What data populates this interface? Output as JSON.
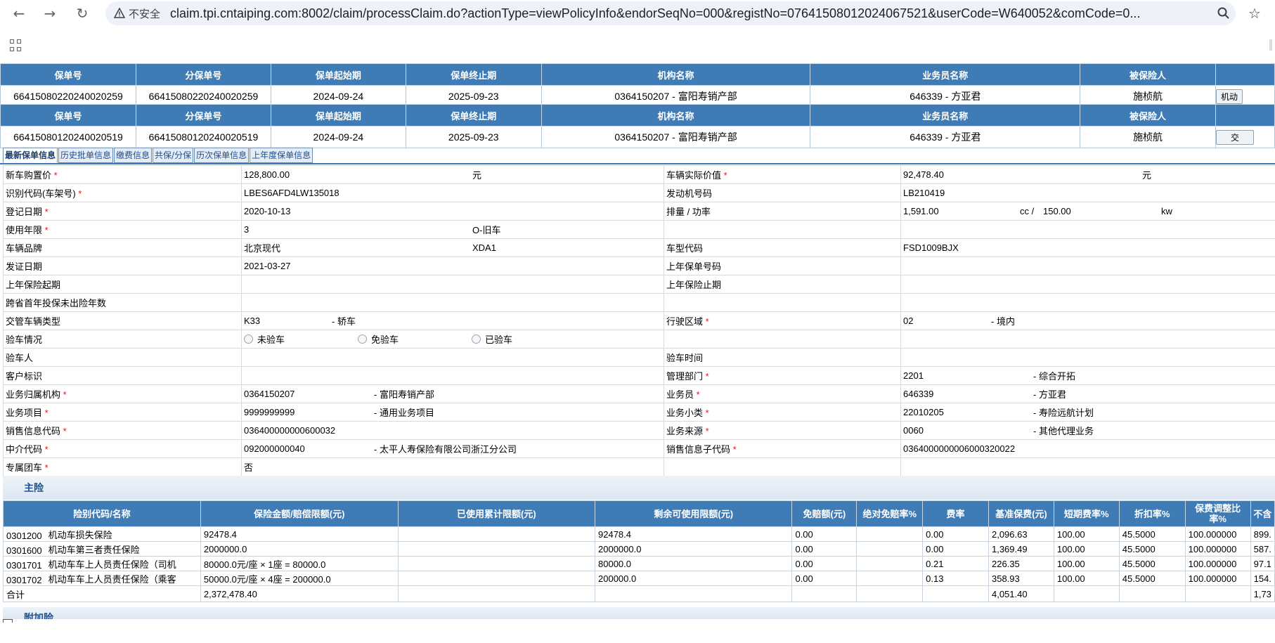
{
  "browser": {
    "insecure_label": "不安全",
    "url": "claim.tpi.cntaiping.com:8002/claim/processClaim.do?actionType=viewPolicyInfo&endorSeqNo=000&registNo=07641508012024067521&userCode=W640052&comCode=0..."
  },
  "policy_headers": [
    "保单号",
    "分保单号",
    "保单起始期",
    "保单终止期",
    "机构名称",
    "业务员名称",
    "被保险人",
    ""
  ],
  "policies": [
    {
      "policy_no": "66415080220240020259",
      "sub_policy_no": "66415080220240020259",
      "start": "2024-09-24",
      "end": "2025-09-23",
      "org": "0364150207 - 富阳寿销产部",
      "agent": "646339 - 方亚君",
      "insured": "施桢航",
      "action": "机动"
    },
    {
      "policy_no": "66415080120240020519",
      "sub_policy_no": "66415080120240020519",
      "start": "2024-09-24",
      "end": "2025-09-23",
      "org": "0364150207 - 富阳寿销产部",
      "agent": "646339 - 方亚君",
      "insured": "施桢航",
      "action": "交"
    }
  ],
  "tabs": [
    "最新保单信息",
    "历史批单信息",
    "缴费信息",
    "共保/分保",
    "历次保单信息",
    "上年度保单信息"
  ],
  "info": {
    "new_car_price_label": "新车购置价",
    "new_car_price": "128,800.00",
    "yuan": "元",
    "actual_value_label": "车辆实际价值",
    "actual_value": "92,478.40",
    "vin_label": "识别代码(车架号)",
    "vin": "LBES6AFD4LW135018",
    "engine_label": "发动机号码",
    "engine": "LB210419",
    "reg_date_label": "登记日期",
    "reg_date": "2020-10-13",
    "displacement_label": "排量 / 功率",
    "displacement": "1,591.00",
    "cc": "cc /",
    "power": "150.00",
    "kw": "kw",
    "years_label": "使用年限",
    "years": "3",
    "car_age": "O-旧车",
    "brand_label": "车辆品牌",
    "brand": "北京现代",
    "brand_code": "XDA1",
    "model_code_label": "车型代码",
    "model_code": "FSD1009BJX",
    "issue_date_label": "发证日期",
    "issue_date": "2021-03-27",
    "last_policy_label": "上年保单号码",
    "last_start_label": "上年保险起期",
    "last_end_label": "上年保险止期",
    "cross_province_label": "跨省首年投保未出险年数",
    "vehicle_type_label": "交管车辆类型",
    "vehicle_type_code": "K33",
    "vehicle_type": "-  轿车",
    "area_label": "行驶区域",
    "area_code": "02",
    "area": "-  境内",
    "inspect_label": "验车情况",
    "inspect_opt1": "未验车",
    "inspect_opt2": "免验车",
    "inspect_opt3": "已验车",
    "inspector_label": "验车人",
    "inspect_time_label": "验车时间",
    "customer_label": "客户标识",
    "mgmt_dept_label": "管理部门",
    "mgmt_dept_code": "2201",
    "mgmt_dept": "-  综合开拓",
    "org_label": "业务归属机构",
    "org_code": "0364150207",
    "org_name": "-  富阳寿销产部",
    "agent_label": "业务员",
    "agent_code": "646339",
    "agent_name": "-  方亚君",
    "project_label": "业务项目",
    "project_code": "9999999999",
    "project_name": "-  通用业务项目",
    "subclass_label": "业务小类",
    "subclass_code": "22010205",
    "subclass_name": "-  寿险远航计划",
    "sales_code_label": "销售信息代码",
    "sales_code": "036400000000600032",
    "source_label": "业务来源",
    "source_code": "0060",
    "source_name": "-  其他代理业务",
    "broker_label": "中介代码",
    "broker_code": "092000000040",
    "broker_name": "-  太平人寿保险有限公司浙江分公司",
    "sales_sub_label": "销售信息子代码",
    "sales_sub": "0364000000006000320022",
    "fleet_label": "专属团车",
    "fleet": "否"
  },
  "main_section": "主险",
  "addon_section": "附加险",
  "coverage": {
    "headers": [
      "险别代码/名称",
      "保险金额/赔偿限额(元)",
      "已使用累计限额(元)",
      "剩余可使用限额(元)",
      "免赔额(元)",
      "绝对免赔率%",
      "费率",
      "基准保费(元)",
      "短期费率%",
      "折扣率%",
      "保费调整比率%",
      "不含"
    ],
    "rows": [
      {
        "code": "0301200",
        "name": "机动车损失保险",
        "amount": "92478.4",
        "used": "",
        "remain": "92478.4",
        "deductible": "0.00",
        "abs_rate": "",
        "rate": "0.00",
        "base": "2,096.63",
        "short": "100.00",
        "discount": "45.5000",
        "adjust": "100.000000",
        "net": "899."
      },
      {
        "code": "0301600",
        "name": "机动车第三者责任保险",
        "amount": "2000000.0",
        "used": "",
        "remain": "2000000.0",
        "deductible": "0.00",
        "abs_rate": "",
        "rate": "0.00",
        "base": "1,369.49",
        "short": "100.00",
        "discount": "45.5000",
        "adjust": "100.000000",
        "net": "587."
      },
      {
        "code": "0301701",
        "name": "机动车车上人员责任保险（司机",
        "amount": "80000.0元/座 × 1座 = 80000.0",
        "used": "",
        "remain": "80000.0",
        "deductible": "0.00",
        "abs_rate": "",
        "rate": "0.21",
        "base": "226.35",
        "short": "100.00",
        "discount": "45.5000",
        "adjust": "100.000000",
        "net": "97.1"
      },
      {
        "code": "0301702",
        "name": "机动车车上人员责任保险（乘客",
        "amount": "50000.0元/座 × 4座 = 200000.0",
        "used": "",
        "remain": "200000.0",
        "deductible": "0.00",
        "abs_rate": "",
        "rate": "0.13",
        "base": "358.93",
        "short": "100.00",
        "discount": "45.5000",
        "adjust": "100.000000",
        "net": "154."
      }
    ],
    "total_label": "合计",
    "total_amount": "2,372,478.40",
    "total_base": "4,051.40",
    "total_net": "1,73"
  }
}
